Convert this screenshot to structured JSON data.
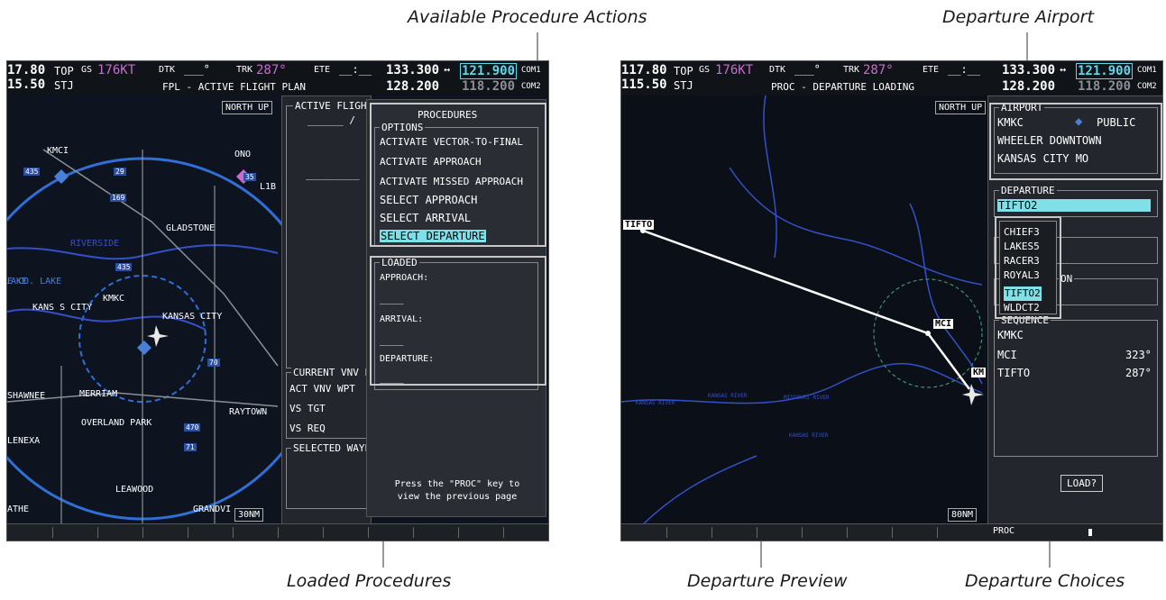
{
  "callouts": {
    "available_actions": "Available Procedure Actions",
    "departure_airport": "Departure Airport",
    "loaded_procedures": "Loaded Procedures",
    "departure_preview": "Departure Preview",
    "departure_choices": "Departure Choices"
  },
  "left": {
    "nav_freq_active": "17.80",
    "nav_freq_standby": "15.50",
    "nav_id_1": "TOP",
    "nav_id_2": "STJ",
    "gs_label": "GS",
    "gs_value": "176KT",
    "dtk_label": "DTK",
    "dtk_value": "___°",
    "trk_label": "TRK",
    "trk_value": "287°",
    "ete_label": "ETE",
    "ete_value": "__:__",
    "com1_active": "133.300",
    "com1_standby": "121.900",
    "com1_label": "COM1",
    "com2_active": "128.200",
    "com2_standby": "118.200",
    "com2_label": "COM2",
    "swap_symbol": "↔",
    "page_title": "FPL - ACTIVE FLIGHT PLAN",
    "north_up": "NORTH UP",
    "range": "30NM",
    "fpl_header": "ACTIVE FLIGHT",
    "fpl_dashes": "______ /",
    "fpl_dashes2": "_________",
    "vnv_header": "CURRENT VNV P",
    "vnv_rows": [
      "ACT VNV WPT",
      "VS TGT",
      "VS REQ"
    ],
    "selected_header": "SELECTED WAYP",
    "map_labels": {
      "kmci": "KMCI",
      "ono": "ONO",
      "gladstone": "GLADSTONE",
      "kmkc": "KMKC",
      "kansas_city_w": "KANS S CITY",
      "kansas_city_e": "KANSAS CITY",
      "co_lake": "E CO. LAKE",
      "shawnee": "SHAWNEE",
      "merriam": "MERRIAM",
      "raytown": "RAYTOWN",
      "overland_park": "OVERLAND PARK",
      "lenexa": "LENEXA",
      "leawood": "LEAWOOD",
      "olathe": "ATHE",
      "grandview": "GRANDVI",
      "riverside": "RIVERSIDE",
      "lake_label": "LAKE",
      "l1b": "L1B",
      "hwy_435_1": "435",
      "hwy_435_2": "435",
      "hwy_29": "29",
      "hwy_169": "169",
      "hwy_35": "35",
      "hwy_70": "70",
      "hwy_71": "71",
      "hwy_470": "470"
    },
    "procedures": {
      "title": "PROCEDURES",
      "options_label": "OPTIONS",
      "items": [
        "ACTIVATE VECTOR-TO-FINAL",
        "ACTIVATE APPROACH",
        "ACTIVATE MISSED APPROACH",
        "SELECT APPROACH",
        "SELECT ARRIVAL",
        "SELECT DEPARTURE"
      ],
      "loaded_label": "LOADED",
      "approach_label": "APPROACH:",
      "approach_value": "____",
      "arrival_label": "ARRIVAL:",
      "arrival_value": "____",
      "departure_label": "DEPARTURE:",
      "departure_value": "____",
      "hint": "Press the \"PROC\" key to view the previous page"
    }
  },
  "right": {
    "nav_freq_active": "117.80",
    "nav_freq_standby": "115.50",
    "nav_id_1": "TOP",
    "nav_id_2": "STJ",
    "gs_label": "GS",
    "gs_value": "176KT",
    "dtk_label": "DTK",
    "dtk_value": "___°",
    "trk_label": "TRK",
    "trk_value": "287°",
    "ete_label": "ETE",
    "ete_value": "__:__",
    "com1_active": "133.300",
    "com1_standby": "121.900",
    "com1_label": "COM1",
    "com2_active": "128.200",
    "com2_standby": "118.200",
    "com2_label": "COM2",
    "swap_symbol": "↔",
    "page_title": "PROC - DEPARTURE LOADING",
    "north_up": "NORTH UP",
    "range": "80NM",
    "waypoints": {
      "tifto": "TIFTO",
      "mci": "MCI",
      "kmkc_partial": "KM"
    },
    "airport": {
      "label": "AIRPORT",
      "id": "KMKC",
      "type": "PUBLIC",
      "name": "WHEELER DOWNTOWN",
      "city": "KANSAS CITY MO"
    },
    "departure": {
      "label": "DEPARTURE",
      "selected": "TIFTO2",
      "choices": [
        "CHIEF3",
        "LAKES5",
        "RACER3",
        "ROYAL3",
        "TIFTO2",
        "WLDCT2"
      ],
      "selected_index": 4,
      "partial_label": "ON"
    },
    "sequence": {
      "label": "SEQUENCE",
      "rows": [
        {
          "wpt": "KMKC",
          "crs": ""
        },
        {
          "wpt": "MCI",
          "crs": "323°"
        },
        {
          "wpt": "TIFTO",
          "crs": "287°"
        }
      ]
    },
    "load_button": "LOAD?",
    "status_label": "PROC",
    "river_labels": [
      "KANSAS RIVER",
      "KANSAS RIVER",
      "KANSAS RIVER",
      "MISSOURI RIVER"
    ]
  },
  "colors": {
    "highlight_bg": "#7fe0e8",
    "magenta": "#c86cd0",
    "airport_diamond": "#4a7fd8",
    "map_blue_line": "#2f6fd6"
  }
}
